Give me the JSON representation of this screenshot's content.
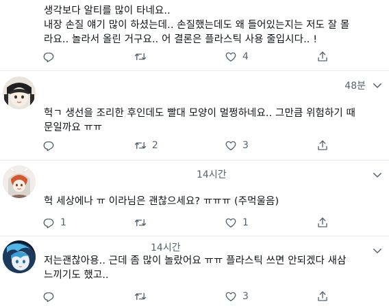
{
  "tweets": [
    {
      "lines": [
        "생각보다 알티를 많이 타네요..",
        "내장 손질 얘기 많이 하셨는데.. 손질했는데도 왜 들어있는지는 저도 잘 몰",
        "라요.. 놀라서 올린 거구요.. 어 결론은 플라스틱 사용 줄입시다.. !"
      ],
      "reply_count": "",
      "retweet_count": "",
      "like_count": "4"
    },
    {
      "time": "48분",
      "lines": [
        "헉ㄱ 생선을 조리한 후인데도 빨대 모양이 멀쩡하네요.. 그만큼 위험하기 때",
        "문일까요 ㅠㅠ"
      ],
      "reply_count": "",
      "retweet_count": "2",
      "like_count": "3"
    },
    {
      "time": "14시간",
      "lines": [
        "헉 세상에나 ㅠ 이라님은 괜찮으세요? ㅠㅠㅠ (주먹울음)"
      ],
      "reply_count": "1",
      "retweet_count": "",
      "like_count": "1"
    },
    {
      "time": "14시간",
      "lines": [
        "저는괜찮아용.. 근데 좀 많이 놀랐어요 ㅠㅠ 플라스틱 쓰면 안되겠다 새삼",
        "느끼기도 했고.."
      ],
      "reply_count": "",
      "retweet_count": "",
      "like_count": "3"
    }
  ],
  "colors": {
    "text": "#0f1419",
    "muted": "#536471",
    "divider": "#e6ecf0"
  },
  "icons": [
    "reply-icon",
    "retweet-icon",
    "like-icon",
    "share-icon",
    "chevron-down-icon"
  ]
}
